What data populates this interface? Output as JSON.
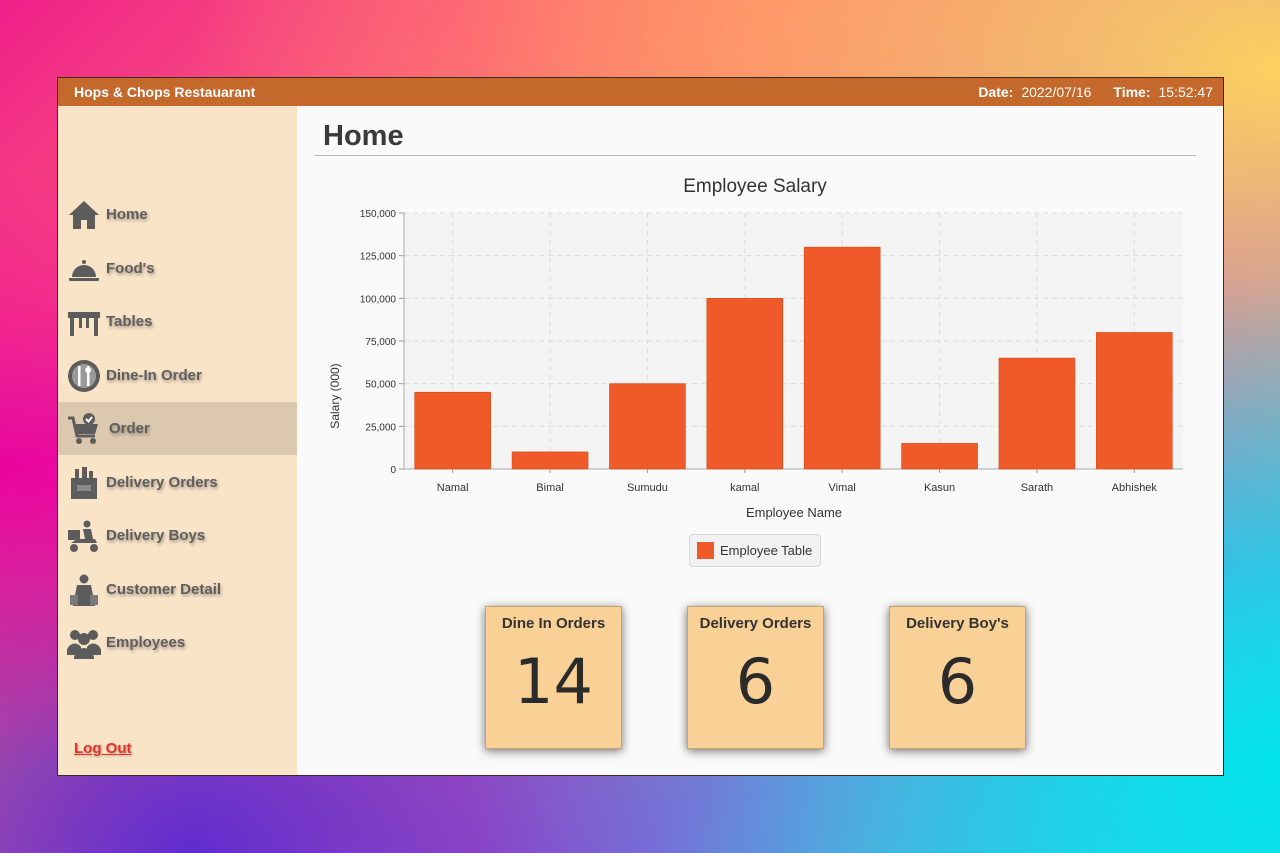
{
  "titlebar": {
    "app_title": "Hops & Chops Restauarant",
    "date_label": "Date:",
    "date_value": "2022/07/16",
    "time_label": "Time:",
    "time_value": "15:52:47"
  },
  "sidebar": {
    "items": [
      {
        "label": "Home",
        "icon": "home-icon"
      },
      {
        "label": "Food's",
        "icon": "cloche-icon"
      },
      {
        "label": "Tables",
        "icon": "table-icon"
      },
      {
        "label": "Dine-In Order",
        "icon": "plate-cutlery-icon"
      },
      {
        "label": "Order",
        "icon": "cart-check-icon",
        "active": true
      },
      {
        "label": "Delivery Orders",
        "icon": "grocery-bag-icon"
      },
      {
        "label": "Delivery Boys",
        "icon": "scooter-delivery-icon"
      },
      {
        "label": "Customer Detail",
        "icon": "customer-icon"
      },
      {
        "label": "Employees",
        "icon": "group-icon"
      }
    ],
    "logout_label": "Log Out"
  },
  "main": {
    "page_title": "Home"
  },
  "chart_data": {
    "type": "bar",
    "title": "Employee Salary",
    "xlabel": "Employee Name",
    "ylabel": "Salary (000)",
    "categories": [
      "Namal",
      "Bimal",
      "Sumudu",
      "kamal",
      "Vimal",
      "Kasun",
      "Sarath",
      "Abhishek"
    ],
    "series": [
      {
        "name": "Employee Table",
        "values": [
          45000,
          10000,
          50000,
          100000,
          130000,
          15000,
          65000,
          80000
        ],
        "color": "#f05a28"
      }
    ],
    "ylim": [
      0,
      150000
    ],
    "yticks": [
      "0",
      "25,000",
      "50,000",
      "75,000",
      "100,000",
      "125,000",
      "150,000"
    ],
    "grid": true,
    "legend_position": "bottom"
  },
  "cards": [
    {
      "title": "Dine In Orders",
      "value": "14"
    },
    {
      "title": "Delivery Orders",
      "value": "6"
    },
    {
      "title": "Delivery Boy's",
      "value": "6"
    }
  ],
  "colors": {
    "titlebar": "#c4682c",
    "sidebar": "#fae4c8",
    "bar": "#f05a28",
    "card": "#f9d095",
    "logout": "#e8302a"
  }
}
